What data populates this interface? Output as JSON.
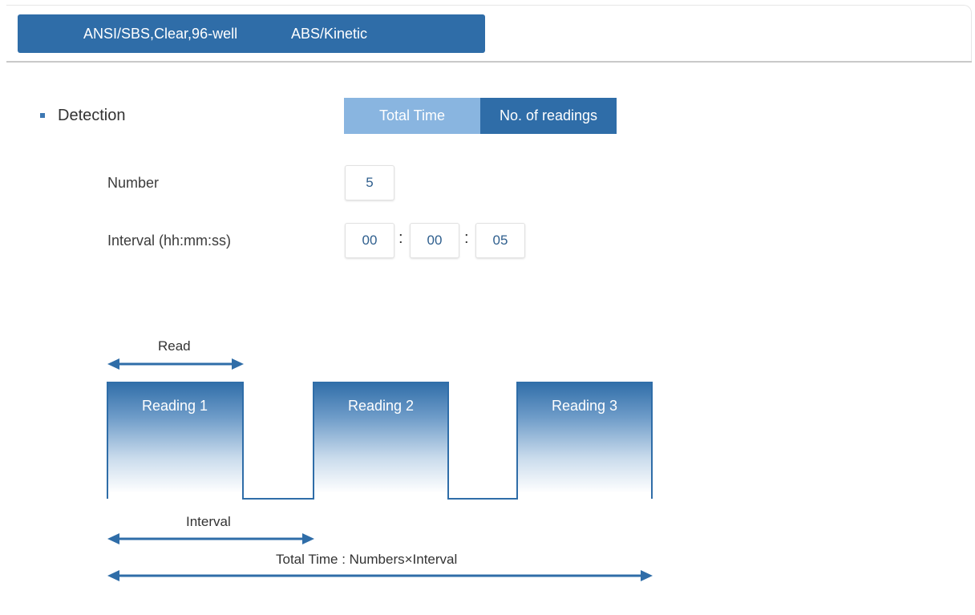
{
  "header": {
    "plate": "ANSI/SBS,Clear,96-well",
    "mode": "ABS/Kinetic"
  },
  "detection": {
    "title": "Detection",
    "toggle": {
      "total_time": "Total Time",
      "no_of_readings": "No. of readings",
      "selected": "No. of readings"
    },
    "number_label": "Number",
    "number_value": "5",
    "interval_label": "Interval (hh:mm:ss)",
    "interval_hh": "00",
    "interval_mm": "00",
    "interval_ss": "05",
    "separator": ":"
  },
  "diagram": {
    "read_label": "Read",
    "readings": [
      "Reading 1",
      "Reading 2",
      "Reading 3"
    ],
    "interval_label": "Interval",
    "total_label": "Total Time : Numbers×Interval"
  },
  "colors": {
    "primary": "#2f6da8",
    "toggle_inactive": "#89b5e0",
    "field_text": "#2f5f8e"
  }
}
